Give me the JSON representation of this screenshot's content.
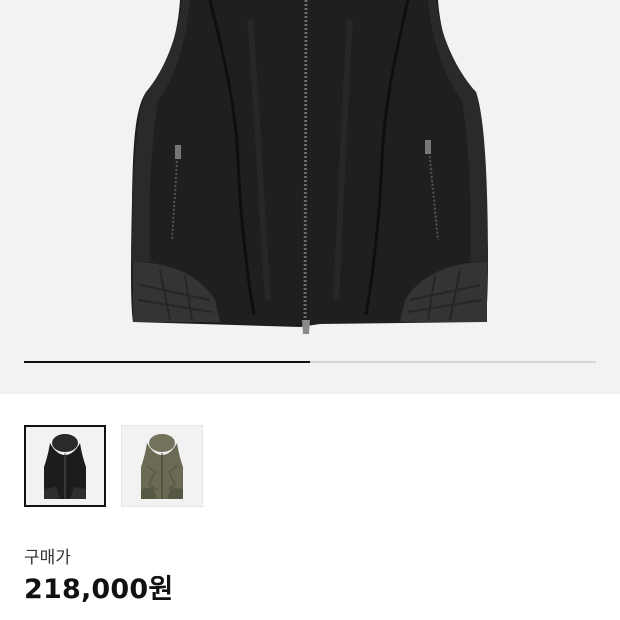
{
  "product": {
    "gallery": {
      "progress": 0.5
    },
    "variants": [
      {
        "icon": "vest-black-thumbnail",
        "color": "#1c1c1c",
        "selected": true
      },
      {
        "icon": "vest-olive-thumbnail",
        "color": "#6b6b55",
        "selected": false
      }
    ],
    "price": {
      "label": "구매가",
      "value": "218,000원"
    }
  }
}
